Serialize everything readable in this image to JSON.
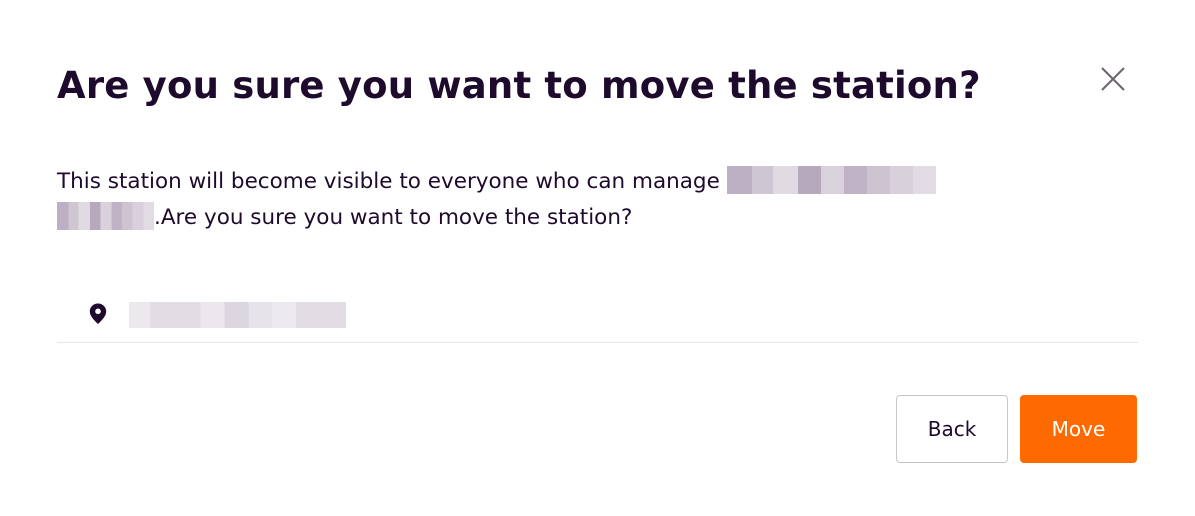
{
  "dialog": {
    "title": "Are you sure you want to move the station?",
    "message_before": "This station will become visible to everyone who can manage ",
    "message_after": ".Are you sure you want to move the station?",
    "close_icon": "close-icon"
  },
  "station": {
    "icon": "location-pin-icon"
  },
  "buttons": {
    "back_label": "Back",
    "move_label": "Move"
  },
  "colors": {
    "accent": "#ff6a00",
    "text": "#1e0a2c",
    "divider": "#e7e4ea"
  }
}
